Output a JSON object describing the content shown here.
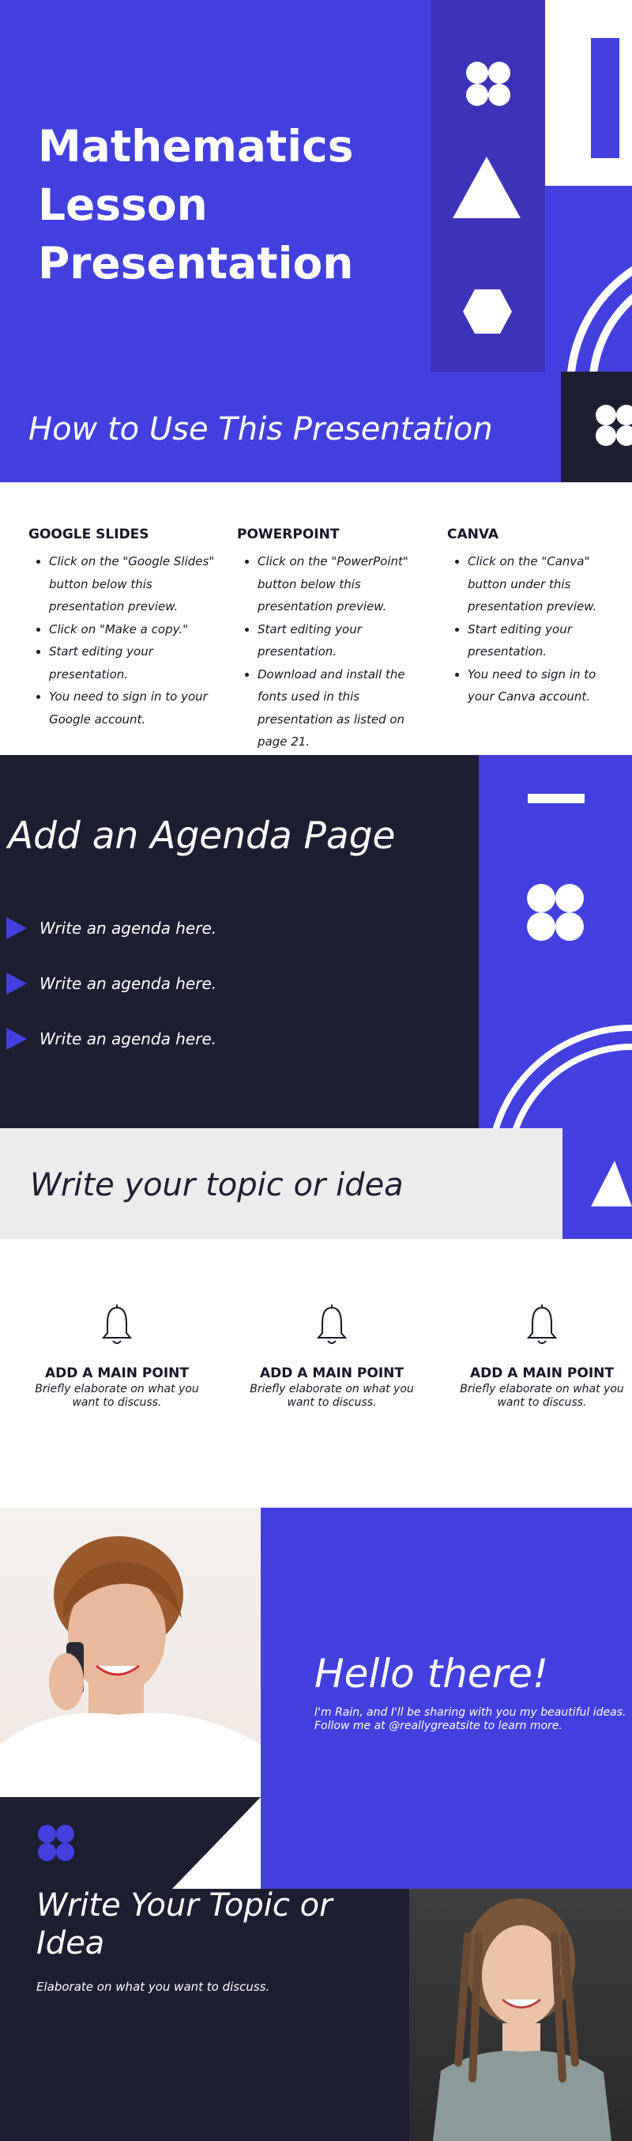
{
  "colors": {
    "accent": "#4340df",
    "dark": "#1e1e33",
    "light": "#ececec",
    "white": "#ffffff"
  },
  "slide1": {
    "title": "Mathematics Lesson Presentation"
  },
  "slide2": {
    "heading": "How to Use This Presentation",
    "columns": [
      {
        "title": "GOOGLE SLIDES",
        "items": [
          "Click on the \"Google Slides\" button below this presentation preview.",
          "Click on \"Make a copy.\"",
          "Start editing your presentation.",
          "You need to sign in to your Google account."
        ]
      },
      {
        "title": "POWERPOINT",
        "items": [
          "Click on the \"PowerPoint\" button below this presentation preview.",
          "Start editing your presentation.",
          "Download and install the fonts used in this presentation as listed on page 21."
        ]
      },
      {
        "title": "CANVA",
        "items": [
          "Click on the \"Canva\" button under this presentation preview.",
          "Start editing your presentation.",
          "You need to sign in to your Canva account."
        ]
      }
    ]
  },
  "slide3": {
    "heading": "Add an Agenda Page",
    "items": [
      "Write an agenda here.",
      "Write an agenda here.",
      "Write an agenda here."
    ]
  },
  "slide4": {
    "heading": "Write your topic or idea",
    "points": [
      {
        "icon": "bell-icon",
        "title": "ADD A MAIN POINT",
        "body": "Briefly elaborate on what you want to discuss."
      },
      {
        "icon": "bell-icon",
        "title": "ADD A MAIN POINT",
        "body": "Briefly elaborate on what you want to discuss."
      },
      {
        "icon": "bell-icon",
        "title": "ADD A MAIN POINT",
        "body": "Briefly elaborate on what you want to discuss."
      }
    ]
  },
  "slide5": {
    "heading": "Hello there!",
    "body": "I'm Rain, and I'll be sharing with you my beautiful ideas. Follow me at @reallygreatsite to learn more."
  },
  "slide6": {
    "heading": "Write Your Topic or Idea",
    "body": "Elaborate on what you want to discuss."
  }
}
